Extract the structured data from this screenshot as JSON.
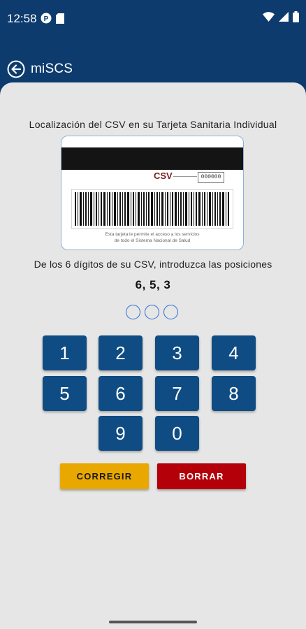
{
  "status_bar": {
    "time": "12:58",
    "left_icons": [
      "notification-app-icon",
      "sd-card-icon"
    ],
    "right_icons": [
      "wifi-icon",
      "signal-icon",
      "battery-icon"
    ]
  },
  "app_bar": {
    "title": "miSCS",
    "back_icon": "back-arrow-icon"
  },
  "card_info": {
    "title": "Localización del CSV en su Tarjeta Sanitaria Individual",
    "csv_label": "CSV",
    "csv_box_text": "000000",
    "card_text_line1": "Esta tarjeta le permite el acceso a los servicios",
    "card_text_line2": "de todo el Sistema Nacional de Salud"
  },
  "instruction": "De los 6 dígitos de su CSV, introduzca las posiciones",
  "positions": "6, 5, 3",
  "keypad": {
    "keys": [
      "1",
      "2",
      "3",
      "4",
      "5",
      "6",
      "7",
      "8",
      "9",
      "0"
    ]
  },
  "actions": {
    "corregir": "CORREGIR",
    "borrar": "BORRAR"
  },
  "colors": {
    "primary": "#0d3b6e",
    "key": "#0f4c83",
    "corregir": "#e8a800",
    "borrar": "#b30009",
    "background": "#e6e6e6"
  }
}
